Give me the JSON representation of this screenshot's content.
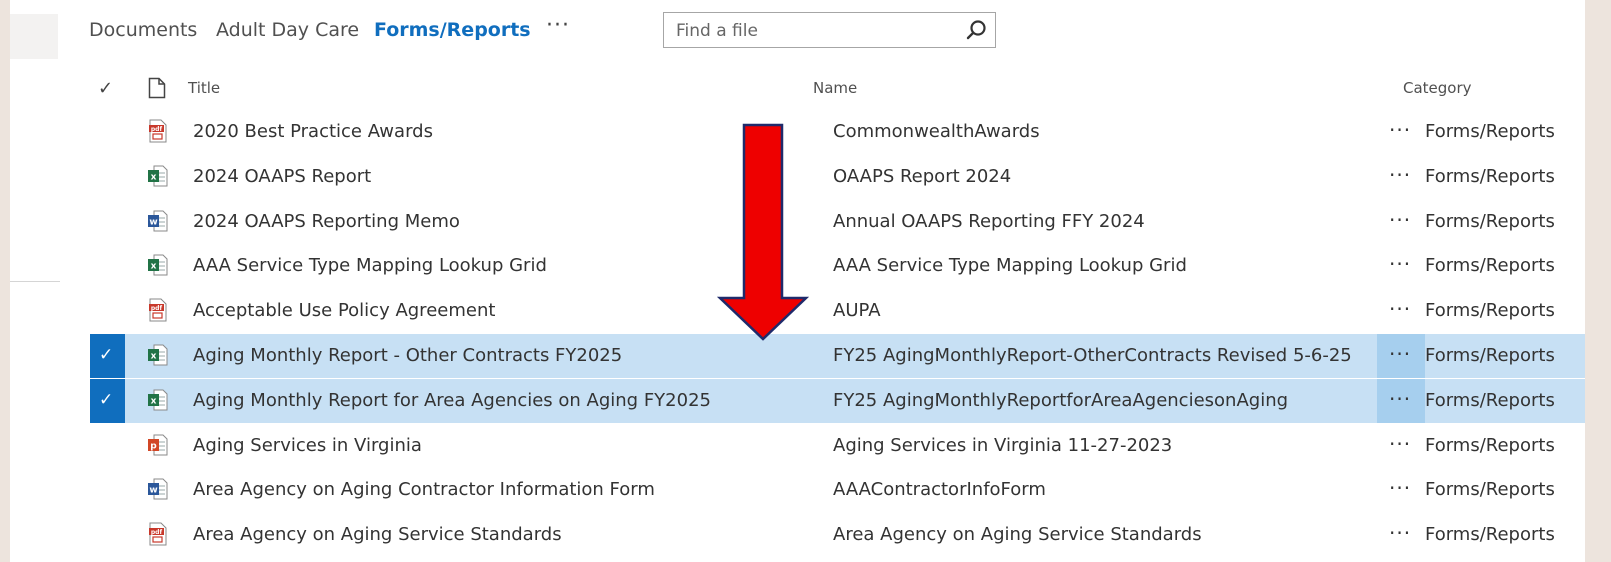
{
  "nav": {
    "links": [
      "Documents",
      "Adult Day Care",
      "Forms/Reports"
    ],
    "active": "Forms/Reports",
    "more_label": "···"
  },
  "search": {
    "placeholder": "Find a file",
    "value": ""
  },
  "list": {
    "columns": {
      "select": "✓",
      "title": "Title",
      "name": "Name",
      "category": "Category"
    },
    "rows": [
      {
        "type": "pdf",
        "title": "2020 Best Practice Awards",
        "name": "CommonwealthAwards",
        "category": "Forms/Reports",
        "selected": false
      },
      {
        "type": "xlsx",
        "title": "2024 OAAPS Report",
        "name": "OAAPS Report 2024",
        "category": "Forms/Reports",
        "selected": false
      },
      {
        "type": "docx",
        "title": "2024 OAAPS Reporting Memo",
        "name": "Annual OAAPS Reporting FFY 2024",
        "category": "Forms/Reports",
        "selected": false
      },
      {
        "type": "xlsx",
        "title": "AAA Service Type Mapping Lookup Grid",
        "name": "AAA Service Type Mapping Lookup Grid",
        "category": "Forms/Reports",
        "selected": false
      },
      {
        "type": "pdf",
        "title": "Acceptable Use Policy Agreement",
        "name": "AUPA",
        "category": "Forms/Reports",
        "selected": false
      },
      {
        "type": "xlsx",
        "title": "Aging Monthly Report - Other Contracts FY2025",
        "name": "FY25 AgingMonthlyReport-OtherContracts Revised 5-6-25",
        "category": "Forms/Reports",
        "selected": true
      },
      {
        "type": "xlsx",
        "title": "Aging Monthly Report for Area Agencies on Aging FY2025",
        "name": "FY25 AgingMonthlyReportforAreaAgenciesonAging",
        "category": "Forms/Reports",
        "selected": true
      },
      {
        "type": "pptx",
        "title": "Aging Services in Virginia",
        "name": "Aging Services in Virginia 11-27-2023",
        "category": "Forms/Reports",
        "selected": false
      },
      {
        "type": "docx",
        "title": "Area Agency on Aging Contractor Information Form",
        "name": "AAAContractorInfoForm",
        "category": "Forms/Reports",
        "selected": false
      },
      {
        "type": "pdf",
        "title": "Area Agency on Aging Service Standards",
        "name": "Area Agency on Aging Service Standards",
        "category": "Forms/Reports",
        "selected": false
      }
    ],
    "more_label": "···",
    "selected_check": "✓"
  },
  "icons": {
    "pdf": "pdf-file-icon",
    "xlsx": "excel-file-icon",
    "docx": "word-file-icon",
    "pptx": "powerpoint-file-icon",
    "search": "search-icon",
    "file_column": "file-type-icon"
  },
  "colors": {
    "accent": "#106ebe",
    "selected_row": "#c7e0f4",
    "annotation_arrow": "#ee0000",
    "pdf": "#c8382b",
    "excel": "#217346",
    "word": "#2b579a",
    "powerpoint": "#d24726"
  }
}
